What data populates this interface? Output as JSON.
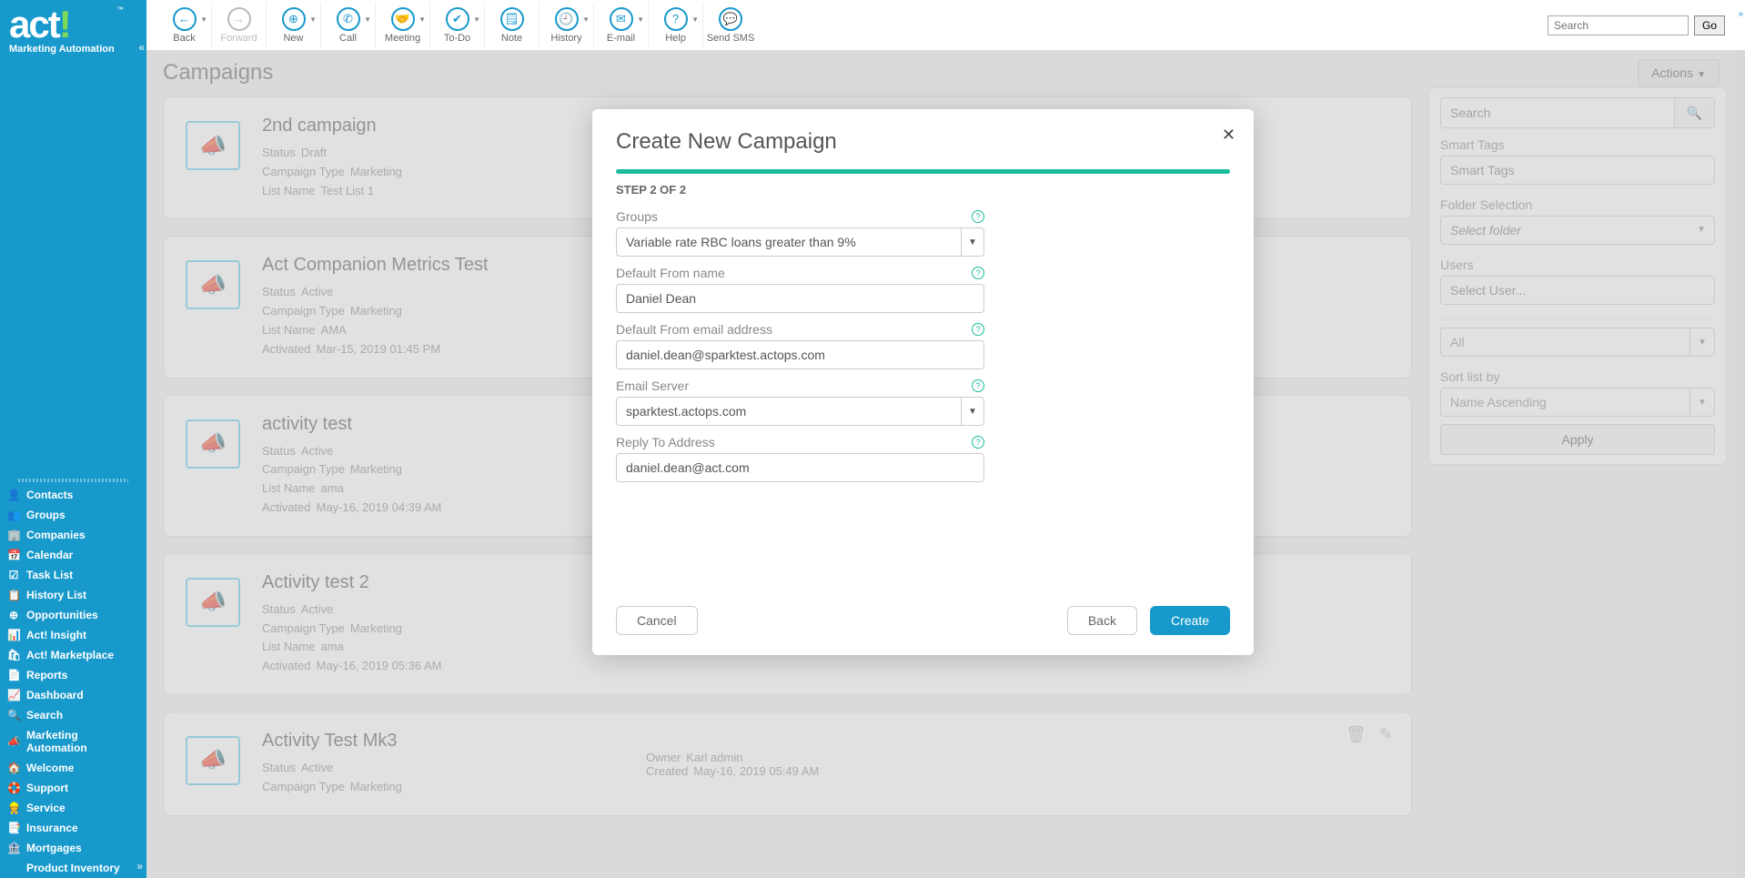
{
  "brand": {
    "name": "act",
    "sub": "Marketing Automation",
    "tm": "™"
  },
  "toolbar": {
    "items": [
      {
        "label": "Back",
        "icon": "←",
        "caret": true
      },
      {
        "label": "Forward",
        "icon": "→",
        "disabled": true
      },
      {
        "label": "New",
        "icon": "⊕",
        "caret": true
      },
      {
        "label": "Call",
        "icon": "✆",
        "caret": true
      },
      {
        "label": "Meeting",
        "icon": "🤝",
        "caret": true
      },
      {
        "label": "To-Do",
        "icon": "✔",
        "caret": true
      },
      {
        "label": "Note",
        "icon": "🗒"
      },
      {
        "label": "History",
        "icon": "🕘",
        "caret": true
      },
      {
        "label": "E-mail",
        "icon": "✉",
        "caret": true
      },
      {
        "label": "Help",
        "icon": "?",
        "caret": true
      },
      {
        "label": "Send SMS",
        "icon": "💬"
      }
    ],
    "search_placeholder": "Search",
    "go_label": "Go"
  },
  "nav": [
    {
      "label": "Contacts",
      "icon": "👤"
    },
    {
      "label": "Groups",
      "icon": "👥"
    },
    {
      "label": "Companies",
      "icon": "🏢"
    },
    {
      "label": "Calendar",
      "icon": "📅"
    },
    {
      "label": "Task List",
      "icon": "☑"
    },
    {
      "label": "History List",
      "icon": "📋"
    },
    {
      "label": "Opportunities",
      "icon": "⊕"
    },
    {
      "label": "Act! Insight",
      "icon": "📊"
    },
    {
      "label": "Act! Marketplace",
      "icon": "🛍"
    },
    {
      "label": "Reports",
      "icon": "📄"
    },
    {
      "label": "Dashboard",
      "icon": "📈"
    },
    {
      "label": "Search",
      "icon": "🔍"
    },
    {
      "label": "Marketing Automation",
      "icon": "📣"
    },
    {
      "label": "Welcome",
      "icon": "🏠"
    },
    {
      "label": "Support",
      "icon": "🛟"
    },
    {
      "label": "Service",
      "icon": "👷"
    },
    {
      "label": "Insurance",
      "icon": "📑"
    },
    {
      "label": "Mortgages",
      "icon": "🏦"
    },
    {
      "label": "Product Inventory",
      "icon": ""
    }
  ],
  "page": {
    "title": "Campaigns",
    "actions_label": "Actions"
  },
  "campaigns": [
    {
      "title": "2nd campaign",
      "status": "Draft",
      "type": "Marketing",
      "list_name": "Test List 1"
    },
    {
      "title": "Act Companion Metrics Test",
      "status": "Active",
      "type": "Marketing",
      "list_name": "AMA",
      "activated": "Mar-15, 2019 01:45 PM"
    },
    {
      "title": "activity test",
      "status": "Active",
      "type": "Marketing",
      "list_name": "ama",
      "activated": "May-16, 2019 04:39 AM"
    },
    {
      "title": "Activity test 2",
      "status": "Active",
      "type": "Marketing",
      "list_name": "ama",
      "activated": "May-16, 2019 05:36 AM"
    },
    {
      "title": "Activity Test Mk3",
      "status": "Active",
      "type": "Marketing",
      "owner": "Karl admin",
      "created": "May-16, 2019 05:49 AM"
    }
  ],
  "labels": {
    "status": "Status",
    "campaign_type": "Campaign Type",
    "list_name": "List Name",
    "activated": "Activated",
    "owner": "Owner",
    "created": "Created"
  },
  "filters": {
    "search_placeholder": "Search",
    "smart_tags_label": "Smart Tags",
    "smart_tags_placeholder": "Smart Tags",
    "folder_label": "Folder Selection",
    "folder_placeholder": "Select folder",
    "users_label": "Users",
    "users_placeholder": "Select User...",
    "select1": "All",
    "sort_label": "Sort list by",
    "sort_value": "Name Ascending",
    "apply": "Apply"
  },
  "modal": {
    "title": "Create New Campaign",
    "step": "STEP 2 OF 2",
    "groups_label": "Groups",
    "groups_value": "Variable rate RBC loans greater than 9%",
    "from_name_label": "Default From name",
    "from_name_value": "Daniel Dean",
    "from_email_label": "Default From email address",
    "from_email_value": "daniel.dean@sparktest.actops.com",
    "server_label": "Email Server",
    "server_value": "sparktest.actops.com",
    "reply_label": "Reply To Address",
    "reply_value": "daniel.dean@act.com",
    "cancel": "Cancel",
    "back": "Back",
    "create": "Create"
  }
}
